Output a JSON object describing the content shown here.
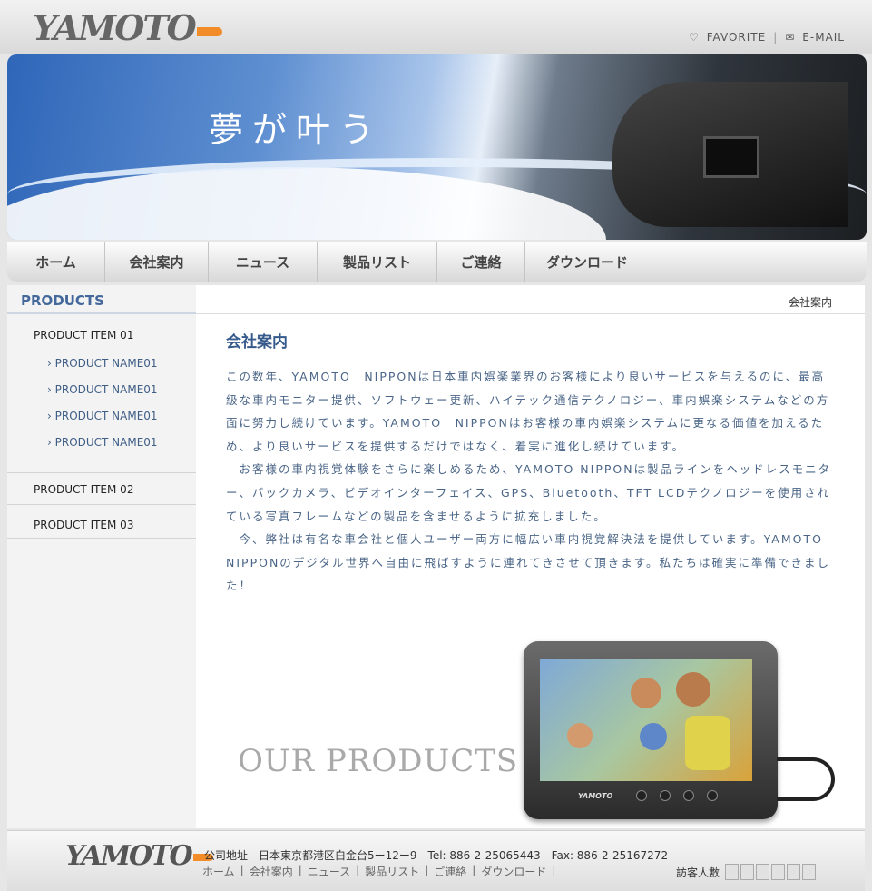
{
  "brand": {
    "logo_text": "YAMOTO",
    "accent": "#f28c28"
  },
  "toplinks": {
    "favorite": "FAVORITE",
    "sep": "|",
    "email": "E-MAIL"
  },
  "hero": {
    "slogan": "夢が叶う"
  },
  "nav": [
    "ホーム",
    "会社案内",
    "ニュース",
    "製品リスト",
    "ご連絡",
    "ダウンロード"
  ],
  "sidebar": {
    "title": "PRODUCTS",
    "groups": [
      {
        "label": "PRODUCT ITEM 01",
        "items": [
          "› PRODUCT NAME01",
          "› PRODUCT NAME01",
          "› PRODUCT NAME01",
          "› PRODUCT NAME01"
        ]
      },
      {
        "label": "PRODUCT ITEM 02"
      },
      {
        "label": "PRODUCT ITEM 03"
      }
    ]
  },
  "main": {
    "breadcrumb": "会社案内",
    "title": "会社案内",
    "paragraphs": [
      "この数年、YAMOTO　NIPPONは日本車内娯楽業界のお客様により良いサービスを与えるのに、最高級な車内モニター提供、ソフトウェー更新、ハイテック通信テクノロジー、車内娯楽システムなどの方面に努力し続けています。YAMOTO　NIPPONはお客様の車内娯楽システムに更なる価値を加えるため、より良いサービスを提供するだけではなく、着実に進化し続けています。",
      "　お客様の車内視覚体験をさらに楽しめるため、YAMOTO NIPPONは製品ラインをヘッドレスモニター、バックカメラ、ビデオインターフェイス、GPS、Bluetooth、TFT LCDテクノロジーを使用されている写真フレームなどの製品を含ませるように拡充しました。",
      "　今、弊社は有名な車会社と個人ユーザー両方に幅広い車内視覚解決法を提供しています。YAMOTO NIPPONのデジタル世界へ自由に飛ばすように連れてきさせて頂きます。私たちは確実に準備できました！"
    ],
    "banner_text": "OUR PRODUCTS",
    "monitor_brand": "YAMOTO"
  },
  "footer": {
    "logo_text": "YAMOTO",
    "address": "公司地址　日本東京都港区白金台5ー12ー9　Tel: 886-2-25065443　Fax: 886-2-25167272",
    "links": [
      "ホーム",
      "|",
      "会社案内",
      "|",
      "ニュース",
      "|",
      "製品リスト",
      "|",
      "ご連絡",
      "|",
      "ダウンロード",
      "|"
    ],
    "visitor_label": "訪客人數"
  }
}
